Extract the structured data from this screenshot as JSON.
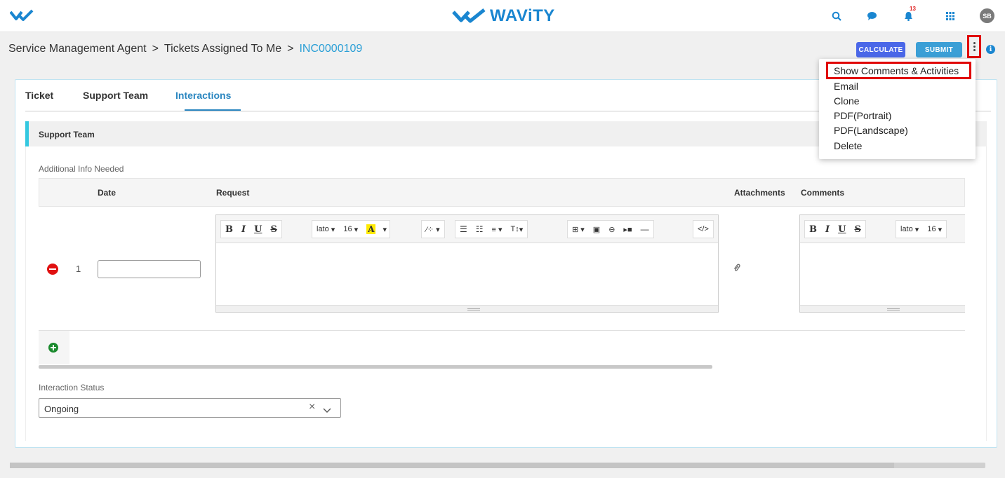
{
  "header": {
    "brand": "WAViTY",
    "notification_count": "13",
    "avatar_initials": "SB"
  },
  "breadcrumb": {
    "items": [
      "Service Management Agent",
      "Tickets Assigned To Me"
    ],
    "separator": ">",
    "current": "INC0000109"
  },
  "actions": {
    "calculate_label": "CALCULATE",
    "submit_label": "SUBMIT"
  },
  "menu": {
    "items": [
      "Show Comments & Activities",
      "Email",
      "Clone",
      "PDF(Portrait)",
      "PDF(Landscape)",
      "Delete"
    ],
    "highlighted": "Show Comments & Activities"
  },
  "tabs": [
    {
      "label": "Ticket",
      "active": false
    },
    {
      "label": "Support Team",
      "active": false
    },
    {
      "label": "Interactions",
      "active": true
    }
  ],
  "section": {
    "title": "Support Team",
    "grid_label": "Additional Info Needed",
    "columns": [
      "Date",
      "Request",
      "Attachments",
      "Comments"
    ],
    "rows": [
      {
        "number": "1",
        "date": "",
        "request": "",
        "comments": ""
      }
    ]
  },
  "editor_toolbar": {
    "bold": "B",
    "italic": "I",
    "underline": "U",
    "strike": "S",
    "font": "lato",
    "font_size": "16",
    "color_letter": "A",
    "text_height": "T↕",
    "code": "</>"
  },
  "status": {
    "label": "Interaction Status",
    "value": "Ongoing"
  },
  "colors": {
    "brand_blue": "#1a86d0",
    "calculate_btn": "#4a67e8",
    "submit_btn": "#3b9fd6",
    "active_tab": "#2a86c0",
    "highlight_red": "#e00000",
    "remove_red": "#e01010",
    "add_green": "#1b8a2e"
  }
}
